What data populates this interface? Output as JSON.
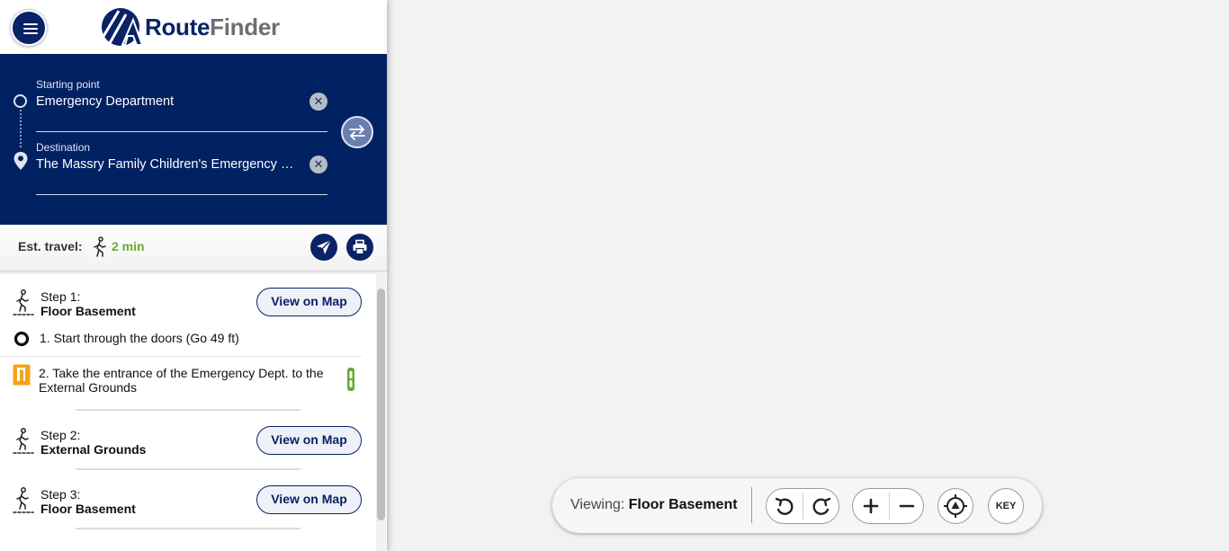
{
  "app": {
    "logo_word_1": "Route",
    "logo_word_2": "Finder",
    "colors": {
      "navy": "#002162",
      "accent_green": "#6aa936",
      "door_orange": "#f5a31a"
    }
  },
  "header": {
    "menu_icon": "hamburger-menu-icon"
  },
  "search": {
    "start_label": "Starting point",
    "start_value": "Emergency Department",
    "dest_label": "Destination",
    "dest_value": "The Massry Family Children's Emergency C...",
    "clear_glyph": "✕",
    "swap_icon": "swap-arrows-icon"
  },
  "travel": {
    "label": "Est. travel:",
    "time": "2 min",
    "mode_icon": "walking-person-icon",
    "send_icon": "send-icon",
    "print_icon": "print-icon"
  },
  "steps": [
    {
      "label": "Step 1:",
      "name": "Floor Basement",
      "button": "View on Map",
      "instructions": [
        {
          "text": "1. Start through the doors (Go 49 ft)",
          "icon": "start-circle-icon"
        },
        {
          "text": "2. Take the entrance of the Emergency Dept. to the External Grounds",
          "icon": "door-exit-icon",
          "side_icon": "connector-icon"
        }
      ]
    },
    {
      "label": "Step 2:",
      "name": "External Grounds",
      "button": "View on Map"
    },
    {
      "label": "Step 3:",
      "name": "Floor Basement",
      "button": "View on Map"
    }
  ],
  "mapbar": {
    "viewing_label": "Viewing:",
    "viewing_value": "Floor Basement",
    "key_label": "KEY"
  }
}
